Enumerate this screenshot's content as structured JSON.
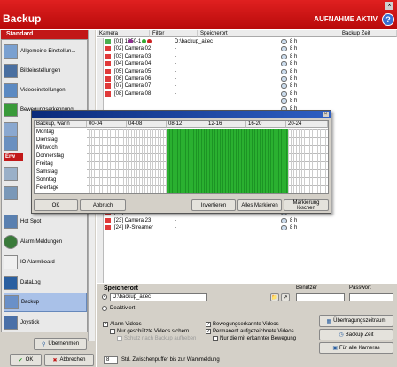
{
  "window": {
    "title": "Backup",
    "status": "AUFNAHME AKTIV",
    "help": "?",
    "close": "×"
  },
  "sidebar": {
    "header": "Standard",
    "items": [
      {
        "label": "Allgemeine Einstellun..."
      },
      {
        "label": "Bildeinstellungen"
      },
      {
        "label": "Videoeinstellungen"
      },
      {
        "label": "Bewegungserkennung"
      },
      {
        "label": ""
      },
      {
        "label": ""
      },
      {
        "label": "Erw"
      },
      {
        "label": ""
      },
      {
        "label": ""
      },
      {
        "label": "Hot Spot"
      },
      {
        "label": "Alarm Meldungen"
      },
      {
        "label": "IO Alarmboard"
      },
      {
        "label": "DataLog"
      },
      {
        "label": "Backup"
      },
      {
        "label": "Joystick"
      }
    ],
    "apply_label": "Übernehmen",
    "ok_label": "OK",
    "cancel_label": "Abbrechen"
  },
  "table": {
    "columns": [
      "Kamera",
      "Filter",
      "Speicherort",
      "Backup Zeit"
    ],
    "rows": [
      {
        "camera": "[01] 1650-1",
        "path": "D:\\backup_aitec",
        "time": "8 h"
      },
      {
        "camera": "[02] Camera 02",
        "path": "-",
        "time": "8 h"
      },
      {
        "camera": "[03] Camera 03",
        "path": "-",
        "time": "8 h"
      },
      {
        "camera": "[04] Camera 04",
        "path": "-",
        "time": "8 h"
      },
      {
        "camera": "[05] Camera 05",
        "path": "-",
        "time": "8 h"
      },
      {
        "camera": "[06] Camera 06",
        "path": "-",
        "time": "8 h"
      },
      {
        "camera": "[07] Camera 07",
        "path": "-",
        "time": "8 h"
      },
      {
        "camera": "[08] Camera 08",
        "path": "-",
        "time": "8 h"
      },
      {
        "camera": "",
        "path": "",
        "time": "8 h"
      },
      {
        "camera": "",
        "path": "",
        "time": "8 h"
      },
      {
        "camera": "",
        "path": "",
        "time": "8 h"
      },
      {
        "camera": "",
        "path": "",
        "time": "8 h"
      },
      {
        "camera": "",
        "path": "",
        "time": "8 h"
      },
      {
        "camera": "",
        "path": "",
        "time": "8 h"
      },
      {
        "camera": "",
        "path": "",
        "time": "8 h"
      },
      {
        "camera": "",
        "path": "",
        "time": "8 h"
      },
      {
        "camera": "",
        "path": "",
        "time": "8 h"
      },
      {
        "camera": "",
        "path": "",
        "time": "8 h"
      },
      {
        "camera": "",
        "path": "",
        "time": "8 h"
      },
      {
        "camera": "",
        "path": "",
        "time": "8 h"
      },
      {
        "camera": "",
        "path": "",
        "time": "8 h"
      },
      {
        "camera": "[20] Camera 20",
        "path": "-",
        "time": "8 h"
      },
      {
        "camera": "[21] Camera 21",
        "path": "-",
        "time": "8 h"
      },
      {
        "camera": "[22] Camera 22",
        "path": "-",
        "time": "8 h"
      },
      {
        "camera": "[23] Camera 23",
        "path": "-",
        "time": "8 h"
      },
      {
        "camera": "[24] IP-Streamer",
        "path": "-",
        "time": "8 h"
      }
    ]
  },
  "schedule": {
    "columns": [
      "Backup, wann",
      "00-04",
      "04-08",
      "08-12",
      "12-16",
      "16-20",
      "20-24"
    ],
    "days": [
      "Montag",
      "Dienstag",
      "Mittwoch",
      "Donnerstag",
      "Freitag",
      "Samstag",
      "Sonntag",
      "Feiertage"
    ],
    "active_hours": [
      8,
      20
    ],
    "buttons": {
      "ok": "OK",
      "cancel": "Abbruch",
      "invert": "Invertieren",
      "mark_all": "Alles Markieren",
      "clear": "Markierung löschen"
    }
  },
  "storage": {
    "title": "Speicherort",
    "path": "D:\\backup_aitec",
    "user_label": "Benutzer",
    "password_label": "Passwort",
    "disabled_label": "Deaktiviert",
    "transfer_button": "Übertragungszeitraum",
    "backup_time_button": "Backup Zeit",
    "all_cameras_button": "Für alle Kameras",
    "alarm_videos": "Alarm Videos",
    "protected_only": "Nur geschützte Videos sichern",
    "protect_after": "Schutz nach Backup aufheben",
    "motion_videos": "Bewegungserkannte Videos",
    "permanent_videos": "Permanent aufgezeichnete Videos",
    "only_motion": "Nur die mit erkannter Bewegung",
    "buffer_value": "8",
    "buffer_label": "Std. Zwischenpuffer bis zur Wammeldung"
  }
}
